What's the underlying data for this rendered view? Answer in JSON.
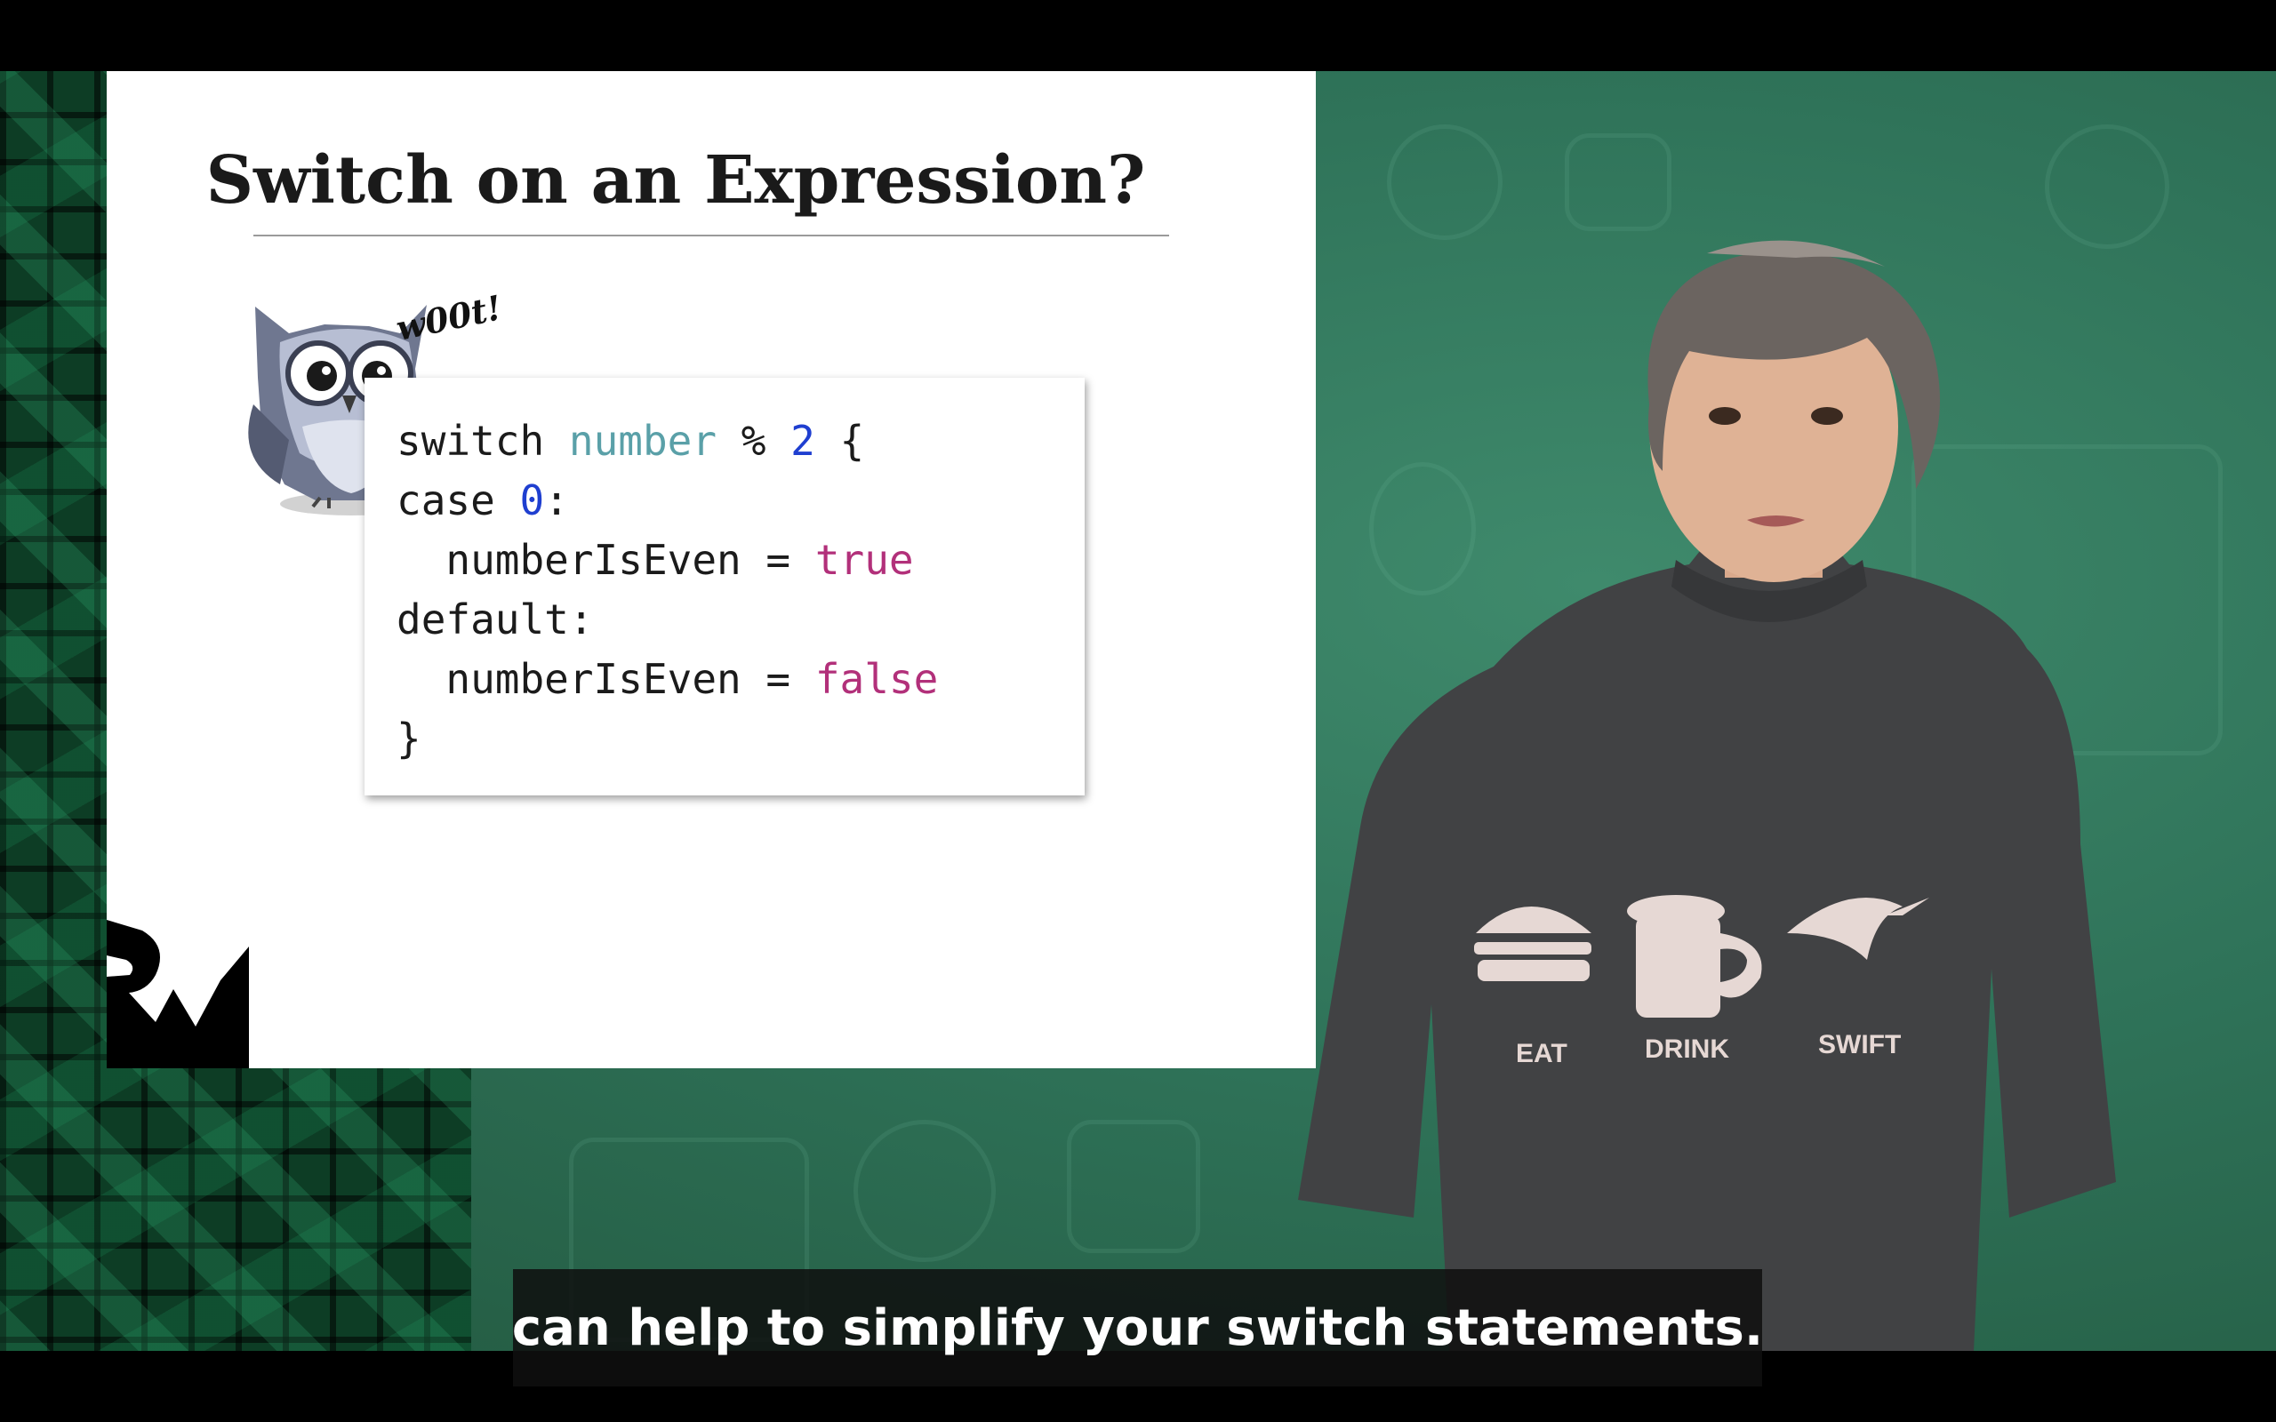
{
  "slide": {
    "title": "Switch on an Expression?",
    "owl_exclamation": "w00t!",
    "code_lines": [
      [
        {
          "t": "switch ",
          "c": "plain"
        },
        {
          "t": "number",
          "c": "var"
        },
        {
          "t": " % ",
          "c": "plain"
        },
        {
          "t": "2",
          "c": "num"
        },
        {
          "t": " {",
          "c": "plain"
        }
      ],
      [
        {
          "t": "case ",
          "c": "plain"
        },
        {
          "t": "0",
          "c": "num"
        },
        {
          "t": ":",
          "c": "plain"
        }
      ],
      [
        {
          "t": "  numberIsEven = ",
          "c": "plain"
        },
        {
          "t": "true",
          "c": "kw"
        }
      ],
      [
        {
          "t": "default:",
          "c": "plain"
        }
      ],
      [
        {
          "t": "  numberIsEven = ",
          "c": "plain"
        },
        {
          "t": "false",
          "c": "kw"
        }
      ],
      [
        {
          "t": "}",
          "c": "plain"
        }
      ]
    ]
  },
  "shirt": {
    "labels": [
      "EAT",
      "DRINK",
      "SWIFT"
    ]
  },
  "caption": {
    "text": "can help to simplify your switch statements."
  },
  "colors": {
    "background_green": "#2f7359",
    "code_variable": "#5aa0a8",
    "code_number": "#1f3fd0",
    "code_keyword": "#b2307a",
    "shirt": "#414244"
  },
  "icons": [
    "owl-mascot-icon",
    "rw-logo-icon",
    "burger-icon",
    "beer-mug-icon",
    "swift-bird-icon"
  ]
}
